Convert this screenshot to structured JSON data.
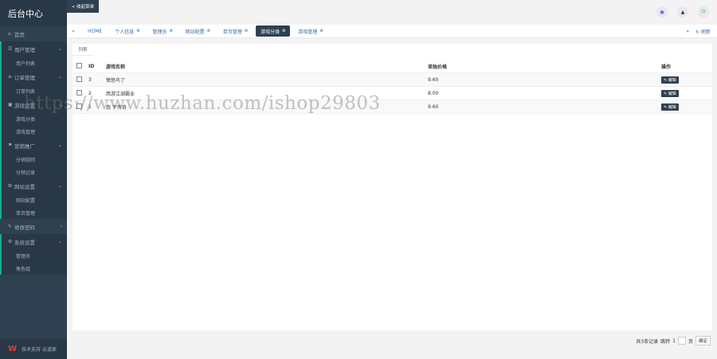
{
  "sidebar": {
    "brand": "后台中心",
    "items": [
      {
        "label": "首页",
        "icon": "home-icon"
      },
      {
        "label": "用户管理",
        "icon": "users-icon",
        "subs": [
          "用户列表"
        ]
      },
      {
        "label": "订单管理",
        "icon": "list-icon",
        "subs": [
          "订单列表"
        ]
      },
      {
        "label": "游戏设置",
        "icon": "gamepad-icon",
        "subs": [
          "游戏分类",
          "游戏管理"
        ]
      },
      {
        "label": "营销推广",
        "icon": "flag-icon",
        "subs": [
          "分销规则",
          "分销记录"
        ]
      },
      {
        "label": "网站设置",
        "icon": "sitemap-icon",
        "subs": [
          "网站配置",
          "单页管理"
        ]
      },
      {
        "label": "修改密码",
        "icon": "edit-icon"
      },
      {
        "label": "系统设置",
        "icon": "gear-icon",
        "subs": [
          "管理员",
          "角色组"
        ]
      }
    ],
    "footer": "技术支持 云道家"
  },
  "header": {
    "back_label": "< 收起菜单"
  },
  "tabs": {
    "items": [
      "HOME",
      "个人信息",
      "管理员",
      "网站配置",
      "单页管理",
      "游戏分类",
      "游戏管理"
    ],
    "refresh_label": "刷新"
  },
  "content": {
    "subtab": "列表",
    "columns": {
      "id": "ID",
      "name": "游戏名称",
      "price": "单独价格",
      "op": "操作"
    },
    "rows": [
      {
        "id": "3",
        "name": "愤怒鸟了",
        "price": "9.60",
        "op": "编辑"
      },
      {
        "id": "2",
        "name": "西游江湖霸业",
        "price": "8.00",
        "op": "编辑"
      },
      {
        "id": "1",
        "name": "我 下传奇",
        "price": "9.60",
        "op": "编辑"
      }
    ]
  },
  "pager": {
    "total": "共3条记录",
    "goto_label": "跳转",
    "page": "1",
    "page_unit": "页",
    "confirm": "确定"
  },
  "watermark": "https://www.huzhan.com/ishop29803",
  "colors": {
    "sidebar": "#2f4050",
    "accent": "#19aa8d",
    "link": "#2f6fae"
  }
}
